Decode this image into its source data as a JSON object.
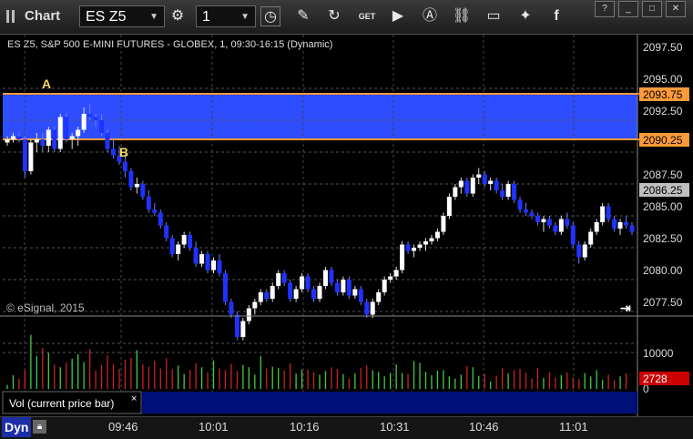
{
  "toolbar": {
    "app_title": "Chart",
    "symbol": "ES Z5",
    "interval": "1",
    "icons": [
      "period-icon",
      "clock-icon",
      "pencil-icon",
      "refresh-icon",
      "get-quote-icon",
      "play-icon",
      "alert-icon",
      "link-icon",
      "comment-icon",
      "twitter-icon",
      "facebook-icon"
    ],
    "window_buttons": [
      "?",
      "_",
      "□",
      "✕"
    ]
  },
  "chart": {
    "title": "ES Z5, S&P 500 E-MINI FUTURES - GLOBEX, 1, 09:30-16:15 (Dynamic)",
    "copyright": "© eSignal, 2015",
    "label_a": "A",
    "label_b": "B",
    "price_ticks": [
      "2097.50",
      "2095.00",
      "2092.50",
      "2090.00",
      "2087.50",
      "2085.00",
      "2082.50",
      "2080.00",
      "2077.50"
    ],
    "upper_marker": "2093.75",
    "lower_marker": "2090.25",
    "last_price": "2086.25",
    "time_ticks": [
      "09:46",
      "10:01",
      "10:16",
      "10:31",
      "10:46",
      "11:01"
    ],
    "colors": {
      "up": "#ffffff",
      "down": "#1f33ff",
      "zone": "#2d4dff",
      "zone_line": "#ff9a3a",
      "vol_up": "#44cc44",
      "vol_down": "#cc2222",
      "last_vol_badge": "#cc0000"
    }
  },
  "volume": {
    "label": "Vol (current price bar)",
    "ticks": [
      "10000",
      "0"
    ],
    "last_volume": "2728"
  },
  "status": {
    "mode": "Dyn"
  },
  "chart_data": {
    "type": "candlestick",
    "ylim": [
      2076.5,
      2099
    ],
    "zone": [
      2090.25,
      2093.75
    ],
    "last": 2086.25,
    "candles": [
      [
        2093.25,
        2093.75,
        2093.0,
        2093.5
      ],
      [
        2093.5,
        2094.0,
        2093.25,
        2093.75
      ],
      [
        2093.75,
        2094.0,
        2093.25,
        2093.5
      ],
      [
        2093.5,
        2093.75,
        2090.5,
        2091.0
      ],
      [
        2091.0,
        2093.5,
        2090.75,
        2093.25
      ],
      [
        2093.25,
        2094.0,
        2092.5,
        2093.5
      ],
      [
        2093.5,
        2094.0,
        2092.5,
        2093.0
      ],
      [
        2093.0,
        2094.5,
        2092.5,
        2094.25
      ],
      [
        2094.25,
        2094.5,
        2092.5,
        2092.75
      ],
      [
        2092.75,
        2095.5,
        2092.5,
        2095.25
      ],
      [
        2095.25,
        2095.5,
        2093.25,
        2093.5
      ],
      [
        2093.5,
        2094.0,
        2092.75,
        2093.75
      ],
      [
        2093.75,
        2094.5,
        2093.0,
        2094.25
      ],
      [
        2094.25,
        2096.0,
        2094.0,
        2095.5
      ],
      [
        2095.5,
        2096.25,
        2095.0,
        2095.25
      ],
      [
        2095.25,
        2095.5,
        2094.5,
        2095.0
      ],
      [
        2095.0,
        2095.5,
        2093.75,
        2094.0
      ],
      [
        2094.0,
        2094.25,
        2092.5,
        2092.75
      ],
      [
        2092.75,
        2093.5,
        2092.0,
        2092.25
      ],
      [
        2092.25,
        2093.0,
        2091.5,
        2091.75
      ],
      [
        2091.75,
        2092.5,
        2090.5,
        2091.0
      ],
      [
        2091.0,
        2091.25,
        2089.5,
        2089.75
      ],
      [
        2089.75,
        2090.5,
        2089.25,
        2090.0
      ],
      [
        2090.0,
        2090.25,
        2088.75,
        2089.0
      ],
      [
        2089.0,
        2089.5,
        2087.75,
        2088.0
      ],
      [
        2088.0,
        2088.5,
        2087.5,
        2087.75
      ],
      [
        2087.75,
        2088.0,
        2086.5,
        2086.75
      ],
      [
        2086.75,
        2087.0,
        2085.5,
        2085.75
      ],
      [
        2085.75,
        2086.0,
        2084.25,
        2084.5
      ],
      [
        2084.5,
        2085.5,
        2084.0,
        2085.25
      ],
      [
        2085.25,
        2086.25,
        2085.0,
        2086.0
      ],
      [
        2086.0,
        2086.25,
        2084.75,
        2085.0
      ],
      [
        2085.0,
        2085.5,
        2083.5,
        2083.75
      ],
      [
        2083.75,
        2084.75,
        2083.5,
        2084.5
      ],
      [
        2084.5,
        2084.75,
        2083.0,
        2083.25
      ],
      [
        2083.25,
        2084.25,
        2083.0,
        2084.0
      ],
      [
        2084.0,
        2084.5,
        2082.75,
        2083.0
      ],
      [
        2083.0,
        2083.25,
        2080.5,
        2080.75
      ],
      [
        2080.75,
        2081.0,
        2079.5,
        2079.75
      ],
      [
        2079.75,
        2080.0,
        2077.75,
        2078.0
      ],
      [
        2078.0,
        2079.5,
        2077.75,
        2079.25
      ],
      [
        2079.25,
        2080.5,
        2079.0,
        2080.25
      ],
      [
        2080.25,
        2081.0,
        2079.75,
        2080.75
      ],
      [
        2080.75,
        2081.75,
        2080.5,
        2081.5
      ],
      [
        2081.5,
        2081.75,
        2080.75,
        2081.0
      ],
      [
        2081.0,
        2082.25,
        2080.75,
        2082.0
      ],
      [
        2082.0,
        2083.25,
        2081.75,
        2083.0
      ],
      [
        2083.0,
        2083.25,
        2082.0,
        2082.25
      ],
      [
        2082.25,
        2082.5,
        2080.75,
        2081.0
      ],
      [
        2081.0,
        2082.0,
        2080.75,
        2081.75
      ],
      [
        2081.75,
        2083.0,
        2081.5,
        2082.75
      ],
      [
        2082.75,
        2083.0,
        2081.5,
        2081.75
      ],
      [
        2081.75,
        2082.0,
        2080.75,
        2081.0
      ],
      [
        2081.0,
        2082.25,
        2080.75,
        2082.0
      ],
      [
        2082.0,
        2083.5,
        2081.75,
        2083.25
      ],
      [
        2083.25,
        2083.5,
        2082.0,
        2082.25
      ],
      [
        2082.25,
        2082.5,
        2081.25,
        2081.5
      ],
      [
        2081.5,
        2082.75,
        2081.25,
        2082.5
      ],
      [
        2082.5,
        2082.75,
        2081.0,
        2081.25
      ],
      [
        2081.25,
        2082.0,
        2081.0,
        2081.75
      ],
      [
        2081.75,
        2082.0,
        2080.5,
        2080.75
      ],
      [
        2080.75,
        2081.0,
        2079.5,
        2079.75
      ],
      [
        2079.75,
        2081.0,
        2079.5,
        2080.75
      ],
      [
        2080.75,
        2081.75,
        2080.5,
        2081.5
      ],
      [
        2081.5,
        2082.75,
        2081.25,
        2082.5
      ],
      [
        2082.5,
        2083.0,
        2082.25,
        2082.75
      ],
      [
        2082.75,
        2083.5,
        2082.5,
        2083.25
      ],
      [
        2083.25,
        2085.5,
        2083.0,
        2085.25
      ],
      [
        2085.25,
        2085.5,
        2084.5,
        2084.75
      ],
      [
        2084.75,
        2085.25,
        2084.25,
        2085.0
      ],
      [
        2085.0,
        2085.5,
        2084.75,
        2085.25
      ],
      [
        2085.25,
        2085.75,
        2084.75,
        2085.5
      ],
      [
        2085.5,
        2086.0,
        2085.25,
        2085.75
      ],
      [
        2085.75,
        2086.5,
        2085.5,
        2086.25
      ],
      [
        2086.25,
        2087.75,
        2086.0,
        2087.5
      ],
      [
        2087.5,
        2089.25,
        2087.25,
        2089.0
      ],
      [
        2089.0,
        2090.0,
        2088.75,
        2089.75
      ],
      [
        2089.75,
        2090.5,
        2089.25,
        2090.25
      ],
      [
        2090.25,
        2090.5,
        2089.0,
        2089.25
      ],
      [
        2089.25,
        2090.75,
        2089.0,
        2090.5
      ],
      [
        2090.5,
        2091.25,
        2090.0,
        2090.75
      ],
      [
        2090.75,
        2091.0,
        2089.75,
        2090.0
      ],
      [
        2090.0,
        2090.5,
        2089.5,
        2090.25
      ],
      [
        2090.25,
        2090.5,
        2089.25,
        2089.5
      ],
      [
        2089.5,
        2090.0,
        2088.75,
        2089.0
      ],
      [
        2089.0,
        2090.25,
        2088.75,
        2090.0
      ],
      [
        2090.0,
        2090.25,
        2088.5,
        2088.75
      ],
      [
        2088.75,
        2089.0,
        2087.75,
        2088.0
      ],
      [
        2088.0,
        2088.5,
        2087.5,
        2087.75
      ],
      [
        2087.75,
        2088.0,
        2087.25,
        2087.5
      ],
      [
        2087.5,
        2087.75,
        2086.75,
        2087.0
      ],
      [
        2087.0,
        2087.5,
        2086.25,
        2087.25
      ],
      [
        2087.25,
        2087.5,
        2086.5,
        2086.75
      ],
      [
        2086.75,
        2087.0,
        2086.0,
        2086.25
      ],
      [
        2086.25,
        2087.5,
        2086.0,
        2087.25
      ],
      [
        2087.25,
        2087.75,
        2086.5,
        2086.75
      ],
      [
        2086.75,
        2087.0,
        2085.0,
        2085.25
      ],
      [
        2085.25,
        2085.5,
        2083.75,
        2084.25
      ],
      [
        2084.25,
        2085.5,
        2084.0,
        2085.25
      ],
      [
        2085.25,
        2086.5,
        2085.0,
        2086.25
      ],
      [
        2086.25,
        2087.25,
        2086.0,
        2087.0
      ],
      [
        2087.0,
        2088.5,
        2086.75,
        2088.25
      ],
      [
        2088.25,
        2088.5,
        2087.0,
        2087.25
      ],
      [
        2087.25,
        2087.5,
        2086.25,
        2086.5
      ],
      [
        2086.5,
        2087.25,
        2086.0,
        2087.0
      ],
      [
        2087.0,
        2087.5,
        2086.5,
        2086.75
      ],
      [
        2086.75,
        2087.0,
        2086.0,
        2086.25
      ]
    ],
    "volumes": [
      700,
      2400,
      1800,
      3300,
      9500,
      5800,
      7200,
      6300,
      4300,
      3800,
      4600,
      5300,
      6100,
      4700,
      7000,
      3200,
      4200,
      5900,
      4400,
      3500,
      5100,
      5500,
      6800,
      4300,
      3900,
      4900,
      3600,
      5400,
      3500,
      4100,
      2600,
      3300,
      4500,
      3800,
      2900,
      5000,
      3600,
      3300,
      4400,
      3100,
      4200,
      3800,
      2500,
      5800,
      3600,
      3900,
      3700,
      3200,
      4500,
      2700,
      3400,
      3400,
      2900,
      2500,
      3100,
      3800,
      3500,
      2600,
      1800,
      2700,
      3700,
      4100,
      3300,
      3000,
      2200,
      2800,
      4300,
      2800,
      2600,
      4900,
      4600,
      3000,
      2400,
      3200,
      3300,
      2200,
      1800,
      2500,
      4000,
      3800,
      2300,
      2600,
      1300,
      2300,
      3600,
      2700,
      3300,
      3500,
      2900,
      1800,
      3700,
      1900,
      2900,
      2000,
      2400,
      2900,
      2000,
      1700,
      2800,
      2200,
      3300,
      1600,
      2500,
      1600,
      2200,
      2728
    ]
  }
}
